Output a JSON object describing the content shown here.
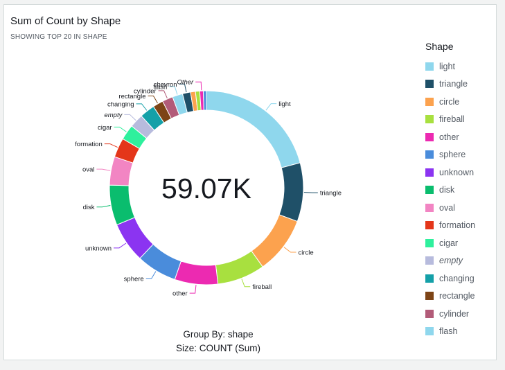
{
  "title": "Sum of Count by Shape",
  "subtitle": "SHOWING TOP 20 IN SHAPE",
  "center_value": "59.07K",
  "footer": {
    "group_by": "Group By: shape",
    "size": "Size: COUNT (Sum)"
  },
  "chart_data": {
    "type": "donut",
    "title": "Sum of Count by Shape",
    "total_label": "59.07K",
    "legend_title": "Shape",
    "legend_position": "right",
    "slices": [
      {
        "label": "light",
        "value": 12100,
        "color": "#8fd7ed"
      },
      {
        "label": "triangle",
        "value": 5680,
        "color": "#1f5068"
      },
      {
        "label": "circle",
        "value": 5520,
        "color": "#fca24e"
      },
      {
        "label": "fireball",
        "value": 4610,
        "color": "#a8e03f"
      },
      {
        "label": "other",
        "value": 4180,
        "color": "#ec2ab1"
      },
      {
        "label": "sphere",
        "value": 3910,
        "color": "#4a8cdb"
      },
      {
        "label": "unknown",
        "value": 3900,
        "color": "#8b34f1"
      },
      {
        "label": "disk",
        "value": 3880,
        "color": "#0abd6e"
      },
      {
        "label": "oval",
        "value": 2750,
        "color": "#f285c3"
      },
      {
        "label": "formation",
        "value": 1880,
        "color": "#e4361a"
      },
      {
        "label": "cigar",
        "value": 1490,
        "color": "#2ef09d"
      },
      {
        "label": "empty",
        "value": 1330,
        "color": "#b7bbdd",
        "italic": true
      },
      {
        "label": "changing",
        "value": 1460,
        "color": "#14a0a8"
      },
      {
        "label": "rectangle",
        "value": 1010,
        "color": "#7d4416"
      },
      {
        "label": "cylinder",
        "value": 1030,
        "color": "#b25b78"
      },
      {
        "label": "flash",
        "value": 1000,
        "color": "#8fd7ed"
      },
      {
        "label": "chevron",
        "value": 770,
        "color": "#1f5068"
      },
      {
        "label": "",
        "value": 480,
        "color": "#fca24e"
      },
      {
        "label": "",
        "value": 410,
        "color": "#a8e03f"
      },
      {
        "label": "Other",
        "value": 340,
        "color": "#ec2ab1",
        "italic": true
      },
      {
        "label": "",
        "value": 300,
        "color": "#4a8cdb"
      }
    ],
    "legend": [
      {
        "label": "light",
        "color": "#8fd7ed"
      },
      {
        "label": "triangle",
        "color": "#1f5068"
      },
      {
        "label": "circle",
        "color": "#fca24e"
      },
      {
        "label": "fireball",
        "color": "#a8e03f"
      },
      {
        "label": "other",
        "color": "#ec2ab1"
      },
      {
        "label": "sphere",
        "color": "#4a8cdb"
      },
      {
        "label": "unknown",
        "color": "#8b34f1"
      },
      {
        "label": "disk",
        "color": "#0abd6e"
      },
      {
        "label": "oval",
        "color": "#f285c3"
      },
      {
        "label": "formation",
        "color": "#e4361a"
      },
      {
        "label": "cigar",
        "color": "#2ef09d"
      },
      {
        "label": "empty",
        "color": "#b7bbdd",
        "italic": true
      },
      {
        "label": "changing",
        "color": "#14a0a8"
      },
      {
        "label": "rectangle",
        "color": "#7d4416"
      },
      {
        "label": "cylinder",
        "color": "#b25b78"
      },
      {
        "label": "flash",
        "color": "#8fd7ed"
      }
    ]
  }
}
